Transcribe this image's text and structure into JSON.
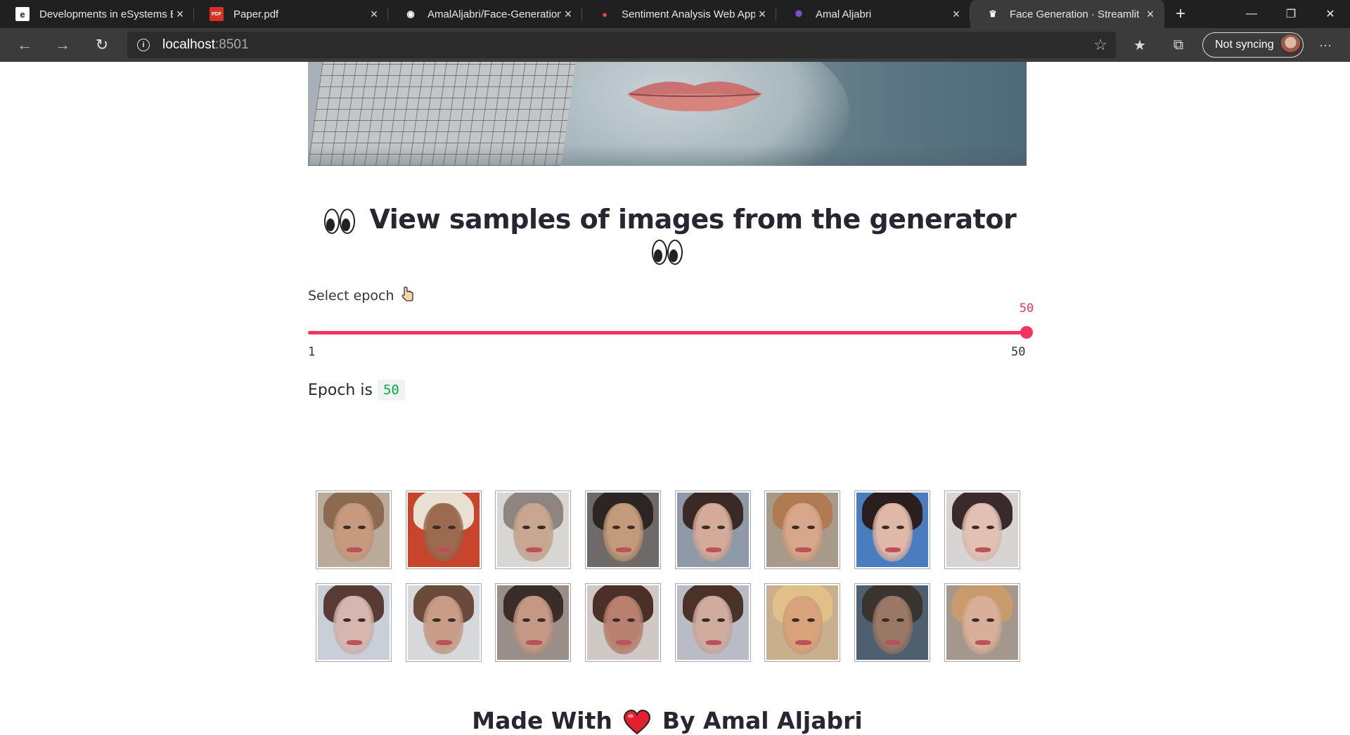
{
  "browser": {
    "tabs": [
      {
        "title": "Developments in eSystems E",
        "icon": "e-icon",
        "icon_color": "#ffffff",
        "active": false
      },
      {
        "title": "Paper.pdf",
        "icon": "pdf-icon",
        "icon_color": "#d93025",
        "active": false
      },
      {
        "title": "AmalAljabri/Face-Generation",
        "icon": "github-icon",
        "icon_color": "#ffffff",
        "active": false
      },
      {
        "title": "Sentiment Analysis Web App",
        "icon": "sentiment-icon",
        "icon_color": "#e0474c",
        "active": false
      },
      {
        "title": "Amal Aljabri",
        "icon": "sparkle-icon",
        "icon_color": "#7b4fd1",
        "active": false
      },
      {
        "title": "Face Generation · Streamlit",
        "icon": "streamlit-icon",
        "icon_color": "#ffffff",
        "active": true
      }
    ],
    "url_host": "localhost",
    "url_port": ":8501",
    "sync_label": "Not syncing",
    "new_tab_glyph": "+",
    "close_glyph": "×",
    "more_glyph": "···"
  },
  "page": {
    "heading": "View samples of images from the generator",
    "slider": {
      "label": "Select epoch",
      "min": 1,
      "max": 50,
      "value": 50,
      "min_label": "1",
      "max_label": "50",
      "value_label": "50",
      "accent": "#f4345c"
    },
    "epoch_text": "Epoch is",
    "epoch_value": "50",
    "faces": [
      {
        "skin": "#c79a7e",
        "hair": "#8c6a4f",
        "bg": "#b9aa9a"
      },
      {
        "skin": "#9b6a4f",
        "hair": "#e8e0d0",
        "bg": "#c8442a"
      },
      {
        "skin": "#c8a690",
        "hair": "#8d8580",
        "bg": "#d8d6d2"
      },
      {
        "skin": "#c39a7a",
        "hair": "#2c2523",
        "bg": "#6d6a68"
      },
      {
        "skin": "#d4aa98",
        "hair": "#3a2a25",
        "bg": "#8e9aa8"
      },
      {
        "skin": "#d8a688",
        "hair": "#b07a52",
        "bg": "#a89a8a"
      },
      {
        "skin": "#e0b8a8",
        "hair": "#2a1f1e",
        "bg": "#4a7cc0"
      },
      {
        "skin": "#e2c0b4",
        "hair": "#3a2a2c",
        "bg": "#d8d4d4"
      },
      {
        "skin": "#d6b6ae",
        "hair": "#5a3a34",
        "bg": "#c8cfd8"
      },
      {
        "skin": "#c89c86",
        "hair": "#6a4a3a",
        "bg": "#d6d8dc"
      },
      {
        "skin": "#c49884",
        "hair": "#3a2c26",
        "bg": "#9a8e88"
      },
      {
        "skin": "#b8806e",
        "hair": "#4a3028",
        "bg": "#d0c8c4"
      },
      {
        "skin": "#d0ac9e",
        "hair": "#4a3228",
        "bg": "#b9bcc4"
      },
      {
        "skin": "#d8a27a",
        "hair": "#e0c088",
        "bg": "#c8b08e"
      },
      {
        "skin": "#9a7866",
        "hair": "#3a3430",
        "bg": "#4e6070"
      },
      {
        "skin": "#d8b09a",
        "hair": "#c89a6c",
        "bg": "#a4988c"
      }
    ],
    "footer_left": "Made With",
    "footer_right": "By Amal Aljabri"
  }
}
